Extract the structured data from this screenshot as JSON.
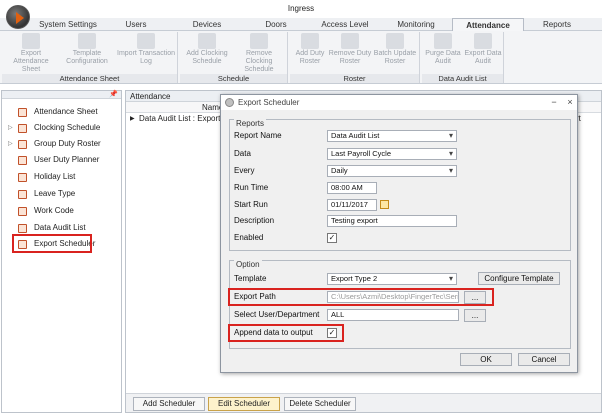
{
  "app": {
    "title": "Ingress",
    "tabs": [
      "System Settings",
      "Users",
      "Devices",
      "Doors",
      "Access Level",
      "Monitoring",
      "Attendance",
      "Reports"
    ],
    "active_tab": "Attendance"
  },
  "ribbon": {
    "groups": [
      {
        "label": "Attendance Sheet",
        "buttons": [
          "Export Attendance Sheet",
          "Template Configuration",
          "Import Transaction Log"
        ]
      },
      {
        "label": "Schedule",
        "buttons": [
          "Add Clocking Schedule",
          "Remove Clocking Schedule"
        ]
      },
      {
        "label": "Roster",
        "buttons": [
          "Add Duty Roster",
          "Remove Duty Roster",
          "Batch Update Roster"
        ]
      },
      {
        "label": "Data Audit List",
        "buttons": [
          "Purge Data Audit",
          "Export Data Audit"
        ]
      }
    ]
  },
  "sidebar": {
    "pin": "📌",
    "items": [
      {
        "label": "Attendance Sheet",
        "expandable": false
      },
      {
        "label": "Clocking Schedule",
        "expandable": true
      },
      {
        "label": "Group Duty Roster",
        "expandable": true
      },
      {
        "label": "User Duty Planner",
        "expandable": false
      },
      {
        "label": "Holiday List",
        "expandable": false
      },
      {
        "label": "Leave Type",
        "expandable": false
      },
      {
        "label": "Work Code",
        "expandable": false
      },
      {
        "label": "Data Audit List",
        "expandable": false
      },
      {
        "label": "Export Scheduler",
        "expandable": false
      }
    ],
    "highlighted": "Export Scheduler"
  },
  "content": {
    "header": "Attendance",
    "column_name": "Name",
    "column_tail": "",
    "row": "Data Audit List : Export Ty",
    "row_tail": "rt",
    "bottom_buttons": [
      "Add Scheduler",
      "Edit Scheduler",
      "Delete Scheduler"
    ]
  },
  "dialog": {
    "title": "Export Scheduler",
    "minimize": "−",
    "close": "×",
    "reports_label": "Reports",
    "report_name_label": "Report Name",
    "report_name_value": "Data Audit List",
    "data_label": "Data",
    "data_value": "Last Payroll Cycle",
    "every_label": "Every",
    "every_value": "Daily",
    "run_time_label": "Run Time",
    "run_time_value": "08:00 AM",
    "start_run_label": "Start Run",
    "start_run_value": "01/11/2017",
    "description_label": "Description",
    "description_value": "Testing export",
    "enabled_label": "Enabled",
    "enabled_checked": "✓",
    "option_label": "Option",
    "template_label": "Template",
    "template_value": "Export Type 2",
    "configure_template": "Configure Template",
    "export_path_label": "Export Path",
    "export_path_value": "C:\\Users\\Azmi\\Desktop\\FingerTec\\Serial",
    "browse": "...",
    "select_user_label": "Select User/Department",
    "select_user_value": "ALL",
    "append_label": "Append data to output",
    "append_checked": "✓",
    "ok": "OK",
    "cancel": "Cancel"
  }
}
